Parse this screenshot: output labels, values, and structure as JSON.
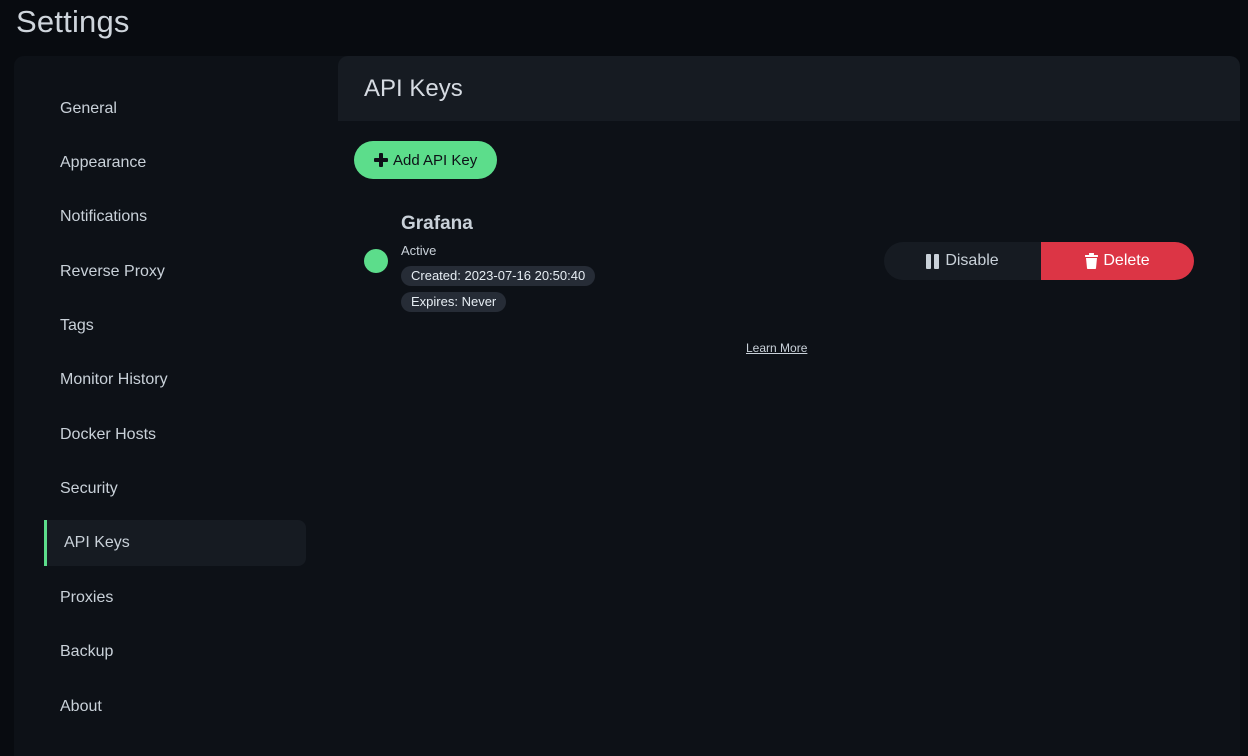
{
  "page": {
    "title": "Settings"
  },
  "sidebar": {
    "items": [
      {
        "label": "General"
      },
      {
        "label": "Appearance"
      },
      {
        "label": "Notifications"
      },
      {
        "label": "Reverse Proxy"
      },
      {
        "label": "Tags"
      },
      {
        "label": "Monitor History"
      },
      {
        "label": "Docker Hosts"
      },
      {
        "label": "Security"
      },
      {
        "label": "API Keys",
        "active": true
      },
      {
        "label": "Proxies"
      },
      {
        "label": "Backup"
      },
      {
        "label": "About"
      }
    ]
  },
  "content": {
    "title": "API Keys",
    "add_button_label": "Add API Key",
    "api_keys": [
      {
        "name": "Grafana",
        "status": "Active",
        "created": "Created: 2023-07-16 20:50:40",
        "expires": "Expires: Never",
        "disable_label": "Disable",
        "delete_label": "Delete"
      }
    ],
    "learn_more_label": "Learn More"
  },
  "colors": {
    "accent": "#5cdd8b",
    "danger": "#dc3545",
    "background": "#080b10",
    "panel": "#0d1117",
    "header": "#161b22"
  },
  "icons": {
    "add": "plus-icon",
    "disable": "pause-icon",
    "delete": "trash-icon"
  }
}
